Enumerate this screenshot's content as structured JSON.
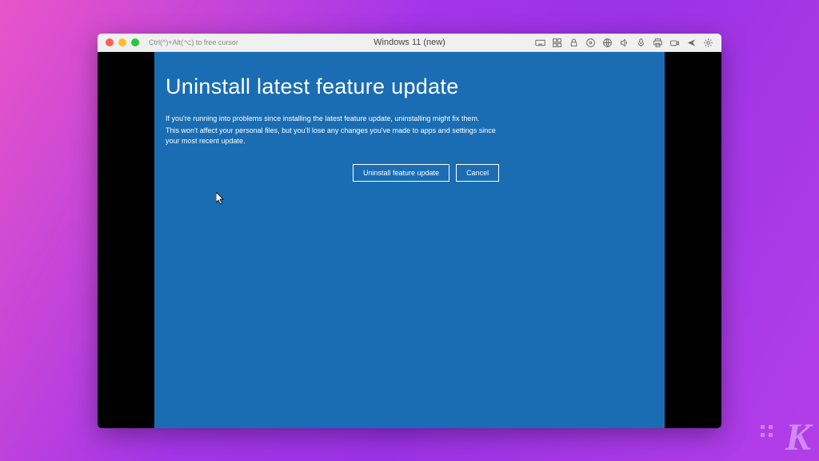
{
  "titlebar": {
    "hint": "Ctrl(^)+Alt(⌥) to free cursor",
    "title": "Windows 11 (new)"
  },
  "recovery": {
    "heading": "Uninstall latest feature update",
    "paragraph1": "If you're running into problems since installing the latest feature update, uninstalling might fix them.",
    "paragraph2": "This won't affect your personal files, but you'll lose any changes you've made to apps and settings since your most recent update.",
    "uninstall_button": "Uninstall feature update",
    "cancel_button": "Cancel"
  },
  "watermark": "K"
}
